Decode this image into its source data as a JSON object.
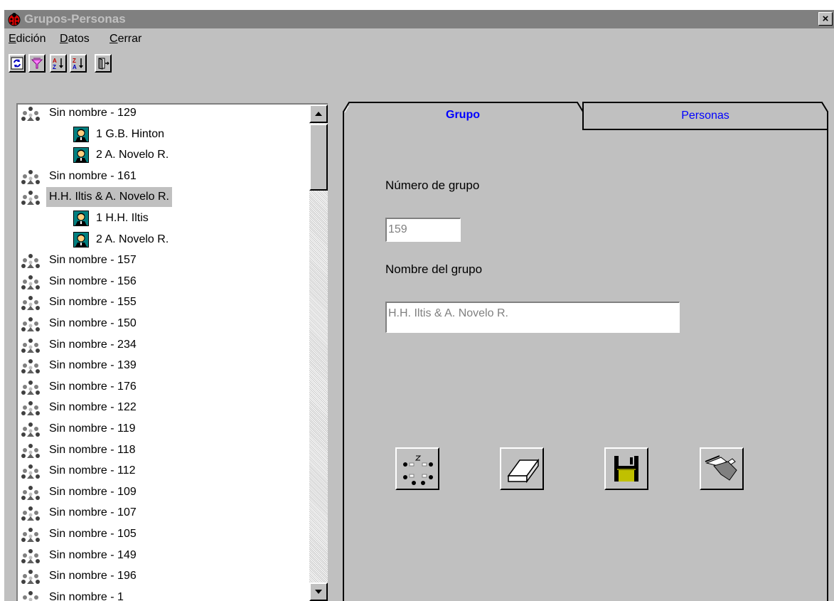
{
  "window": {
    "title": "Grupos-Personas",
    "close_glyph": "×"
  },
  "menu": [
    {
      "label": "Edición",
      "underline": "E",
      "rest": "dición"
    },
    {
      "label": "Datos",
      "underline": "D",
      "rest": "atos"
    },
    {
      "label": "Cerrar",
      "underline": "C",
      "rest": "errar"
    }
  ],
  "toolbar": {
    "buttons": [
      {
        "icon": "refresh-icon"
      },
      {
        "icon": "filter-icon"
      },
      {
        "icon": "sort-ascending-icon",
        "text": [
          "A",
          "Z"
        ]
      },
      {
        "icon": "sort-descending-icon",
        "text": [
          "Z",
          "A"
        ]
      },
      {
        "icon": "exit-door-icon"
      }
    ]
  },
  "tree": {
    "items": [
      {
        "type": "group",
        "label": "Sin nombre - 129"
      },
      {
        "type": "person",
        "label": "1 G.B. Hinton"
      },
      {
        "type": "person",
        "label": "2 A. Novelo R."
      },
      {
        "type": "group",
        "label": "Sin nombre - 161"
      },
      {
        "type": "group",
        "label": "H.H. Iltis & A. Novelo R.",
        "selected": true
      },
      {
        "type": "person",
        "label": "1 H.H. Iltis"
      },
      {
        "type": "person",
        "label": "2 A. Novelo R."
      },
      {
        "type": "group",
        "label": "Sin nombre - 157"
      },
      {
        "type": "group",
        "label": "Sin nombre - 156"
      },
      {
        "type": "group",
        "label": "Sin nombre - 155"
      },
      {
        "type": "group",
        "label": "Sin nombre - 150"
      },
      {
        "type": "group",
        "label": "Sin nombre - 234"
      },
      {
        "type": "group",
        "label": "Sin nombre - 139"
      },
      {
        "type": "group",
        "label": "Sin nombre - 176"
      },
      {
        "type": "group",
        "label": "Sin nombre - 122"
      },
      {
        "type": "group",
        "label": "Sin nombre - 119"
      },
      {
        "type": "group",
        "label": "Sin nombre - 118"
      },
      {
        "type": "group",
        "label": "Sin nombre - 112"
      },
      {
        "type": "group",
        "label": "Sin nombre - 109"
      },
      {
        "type": "group",
        "label": "Sin nombre - 107"
      },
      {
        "type": "group",
        "label": "Sin nombre - 105"
      },
      {
        "type": "group",
        "label": "Sin nombre - 149"
      },
      {
        "type": "group",
        "label": "Sin nombre - 196"
      },
      {
        "type": "group",
        "label": "Sin nombre - 1"
      }
    ]
  },
  "tabs": [
    {
      "label": "Grupo",
      "active": true
    },
    {
      "label": "Personas",
      "active": false
    }
  ],
  "form": {
    "group_number_label": "Número de grupo",
    "group_number_value": "159",
    "group_name_label": "Nombre del grupo",
    "group_name_value": "H.H. Iltis & A. Novelo R."
  },
  "actions": [
    {
      "icon": "new-group-icon"
    },
    {
      "icon": "eraser-icon"
    },
    {
      "icon": "save-disk-icon"
    },
    {
      "icon": "edit-hand-icon"
    }
  ],
  "colors": {
    "face": "#c0c0c0",
    "titlebar": "#808080",
    "tab_text": "#0000ff"
  }
}
